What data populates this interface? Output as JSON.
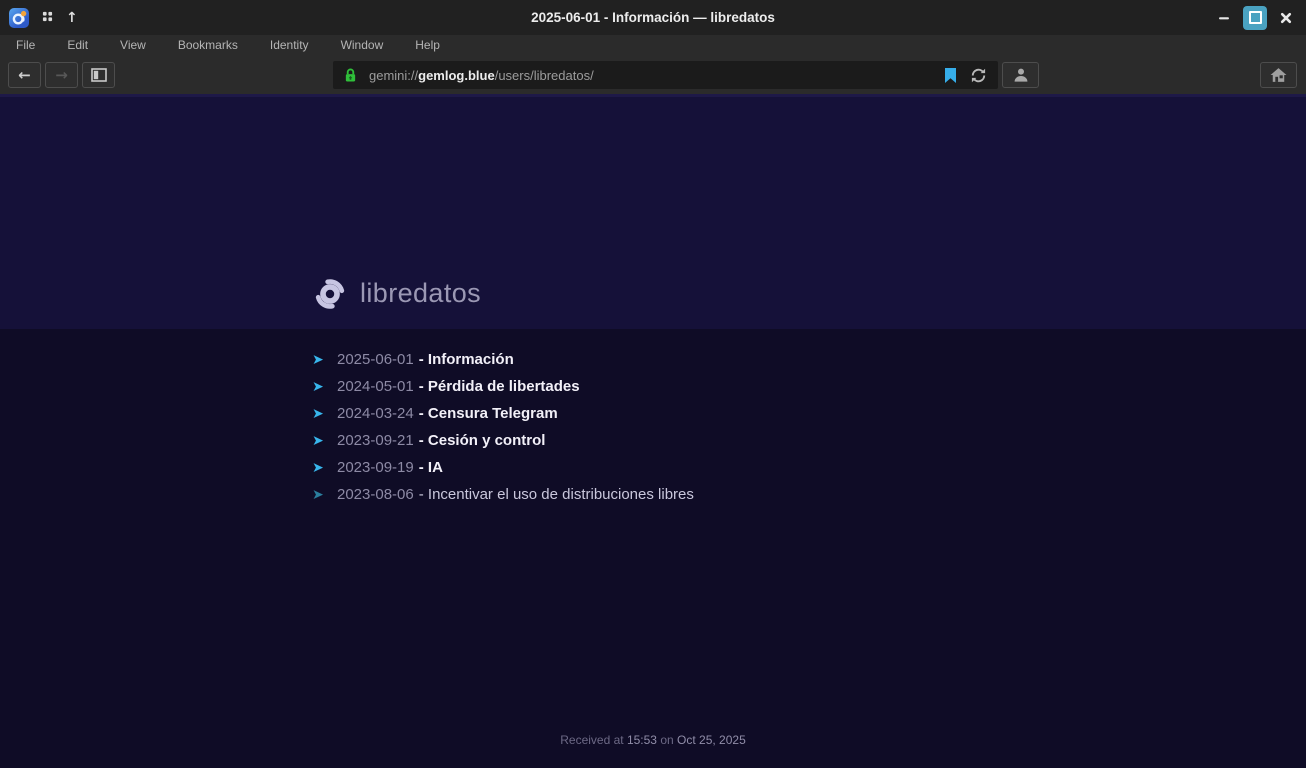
{
  "window": {
    "title": "2025-06-01 - Información — libredatos",
    "up_glyph": "↑"
  },
  "menu": {
    "items": [
      "File",
      "Edit",
      "View",
      "Bookmarks",
      "Identity",
      "Window",
      "Help"
    ]
  },
  "toolbar": {
    "back_glyph": "←",
    "forward_glyph": "→",
    "url": {
      "scheme": "gemini://",
      "host": "gemlog.blue",
      "path": "/users/libredatos/"
    }
  },
  "content": {
    "site_title": "libredatos",
    "link_arrow": "➤",
    "links": [
      {
        "date": "2025-06-01",
        "title": "- Información",
        "visited": false
      },
      {
        "date": "2024-05-01",
        "title": "- Pérdida de libertades",
        "visited": false
      },
      {
        "date": "2024-03-24",
        "title": "- Censura Telegram",
        "visited": false
      },
      {
        "date": "2023-09-21",
        "title": "- Cesión y control",
        "visited": false
      },
      {
        "date": "2023-09-19",
        "title": "- IA",
        "visited": false
      },
      {
        "date": "2023-08-06",
        "title": "- Incentivar el uso de distribuciones libres",
        "visited": true
      }
    ],
    "footer": {
      "received_label": "Received at",
      "time": "15:53",
      "on_label": "on",
      "date": "Oct 25, 2025"
    }
  },
  "colors": {
    "accent_link": "#38b6ec",
    "visited_link": "#2b7e9d",
    "lock_green": "#2fbf3a",
    "bookmark_blue": "#36aeea",
    "maximize_teal": "#4aa2c1",
    "page_bg": "#0f0c26",
    "banner_bg": "#151139"
  }
}
